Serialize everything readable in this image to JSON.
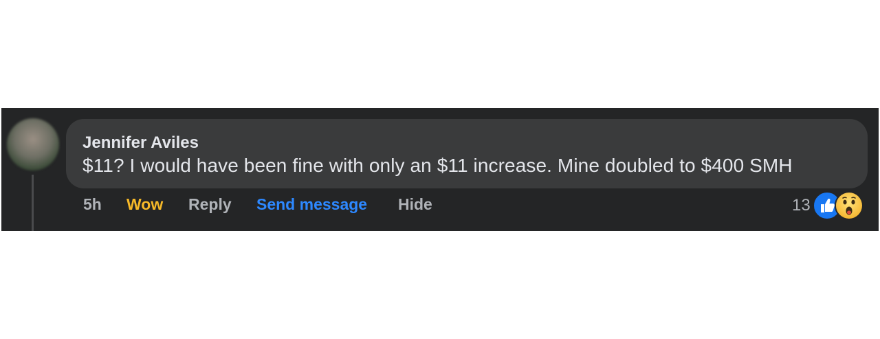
{
  "comment": {
    "author": "Jennifer Aviles",
    "text": "$11? I would have been fine with only an $11 increase. Mine doubled to $400 SMH"
  },
  "actions": {
    "time": "5h",
    "reaction_label": "Wow",
    "reply_label": "Reply",
    "send_message_label": "Send message",
    "hide_label": "Hide"
  },
  "reactions": {
    "count": "13",
    "icons": [
      "like-icon",
      "wow-icon"
    ]
  },
  "colors": {
    "background": "#242526",
    "bubble": "#3a3b3c",
    "text": "#e4e6eb",
    "muted": "#b0b3b8",
    "wow": "#f7b928",
    "link": "#2d88ff",
    "like": "#1877f2"
  }
}
